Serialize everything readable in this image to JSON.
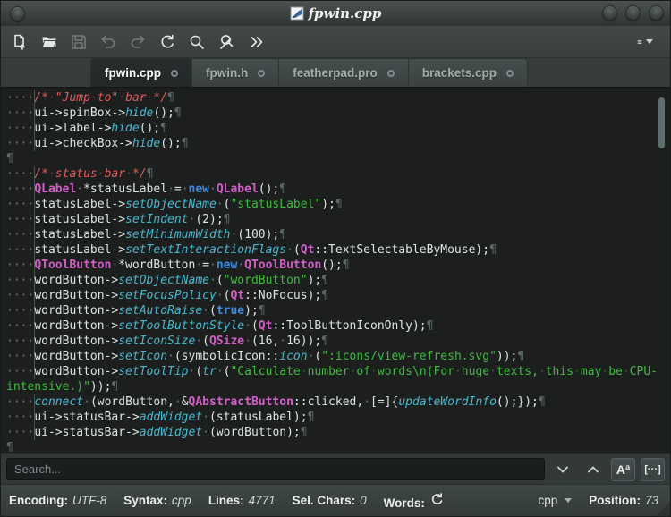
{
  "window": {
    "title": "fpwin.cpp",
    "controls": [
      "window-menu",
      "minimize",
      "maximize",
      "close"
    ]
  },
  "toolbar": {
    "icons": [
      {
        "name": "new-file",
        "enabled": true
      },
      {
        "name": "open-file",
        "enabled": true
      },
      {
        "name": "save",
        "enabled": false
      },
      {
        "name": "undo",
        "enabled": false
      },
      {
        "name": "redo",
        "enabled": false
      },
      {
        "name": "reload",
        "enabled": true
      },
      {
        "name": "find",
        "enabled": true
      },
      {
        "name": "find-replace",
        "enabled": true
      },
      {
        "name": "more-tools",
        "enabled": true
      },
      {
        "name": "main-menu",
        "enabled": true
      }
    ]
  },
  "tabs": [
    {
      "label": "fpwin.cpp",
      "active": true
    },
    {
      "label": "fpwin.h",
      "active": false
    },
    {
      "label": "featherpad.pro",
      "active": false
    },
    {
      "label": "brackets.cpp",
      "active": false
    }
  ],
  "editor": {
    "token_colors": {
      "tx": "#dfe3e3",
      "cm": "#e25b5b",
      "fn": "#49b8cf",
      "kw": "#3f8ae0",
      "ty": "#d45fc8",
      "st": "#3fba3f",
      "pi": "#5d6868",
      "lead": "#dfe3e3"
    },
    "lines": [
      [
        [
          "lead",
          "····"
        ],
        [
          "cm",
          "/*·\"Jump·to\"·bar·*/"
        ],
        [
          "pi",
          "¶"
        ]
      ],
      [
        [
          "lead",
          "····"
        ],
        [
          "tx",
          "ui->spinBox->"
        ],
        [
          "fn",
          "hide"
        ],
        [
          "tx",
          "();"
        ],
        [
          "pi",
          "¶"
        ]
      ],
      [
        [
          "lead",
          "····"
        ],
        [
          "tx",
          "ui->label->"
        ],
        [
          "fn",
          "hide"
        ],
        [
          "tx",
          "();"
        ],
        [
          "pi",
          "¶"
        ]
      ],
      [
        [
          "lead",
          "····"
        ],
        [
          "tx",
          "ui->checkBox->"
        ],
        [
          "fn",
          "hide"
        ],
        [
          "tx",
          "();"
        ],
        [
          "pi",
          "¶"
        ]
      ],
      [
        [
          "pi",
          "¶"
        ]
      ],
      [
        [
          "lead",
          "····"
        ],
        [
          "cm",
          "/*·status·bar·*/"
        ],
        [
          "pi",
          "¶"
        ]
      ],
      [
        [
          "lead",
          "····"
        ],
        [
          "ty",
          "QLabel"
        ],
        [
          "tx",
          "·*statusLabel·=·"
        ],
        [
          "kw",
          "new"
        ],
        [
          "tx",
          "·"
        ],
        [
          "ty",
          "QLabel"
        ],
        [
          "tx",
          "();"
        ],
        [
          "pi",
          "¶"
        ]
      ],
      [
        [
          "lead",
          "····"
        ],
        [
          "tx",
          "statusLabel->"
        ],
        [
          "fn",
          "setObjectName"
        ],
        [
          "tx",
          "·("
        ],
        [
          "st",
          "\"statusLabel\""
        ],
        [
          "tx",
          ");"
        ],
        [
          "pi",
          "¶"
        ]
      ],
      [
        [
          "lead",
          "····"
        ],
        [
          "tx",
          "statusLabel->"
        ],
        [
          "fn",
          "setIndent"
        ],
        [
          "tx",
          "·(2);"
        ],
        [
          "pi",
          "¶"
        ]
      ],
      [
        [
          "lead",
          "····"
        ],
        [
          "tx",
          "statusLabel->"
        ],
        [
          "fn",
          "setMinimumWidth"
        ],
        [
          "tx",
          "·(100);"
        ],
        [
          "pi",
          "¶"
        ]
      ],
      [
        [
          "lead",
          "····"
        ],
        [
          "tx",
          "statusLabel->"
        ],
        [
          "fn",
          "setTextInteractionFlags"
        ],
        [
          "tx",
          "·("
        ],
        [
          "ty",
          "Qt"
        ],
        [
          "tx",
          "::TextSelectableByMouse);"
        ],
        [
          "pi",
          "¶"
        ]
      ],
      [
        [
          "lead",
          "····"
        ],
        [
          "ty",
          "QToolButton"
        ],
        [
          "tx",
          "·*wordButton·=·"
        ],
        [
          "kw",
          "new"
        ],
        [
          "tx",
          "·"
        ],
        [
          "ty",
          "QToolButton"
        ],
        [
          "tx",
          "();"
        ],
        [
          "pi",
          "¶"
        ]
      ],
      [
        [
          "lead",
          "····"
        ],
        [
          "tx",
          "wordButton->"
        ],
        [
          "fn",
          "setObjectName"
        ],
        [
          "tx",
          "·("
        ],
        [
          "st",
          "\"wordButton\""
        ],
        [
          "tx",
          ");"
        ],
        [
          "pi",
          "¶"
        ]
      ],
      [
        [
          "lead",
          "····"
        ],
        [
          "tx",
          "wordButton->"
        ],
        [
          "fn",
          "setFocusPolicy"
        ],
        [
          "tx",
          "·("
        ],
        [
          "ty",
          "Qt"
        ],
        [
          "tx",
          "::NoFocus);"
        ],
        [
          "pi",
          "¶"
        ]
      ],
      [
        [
          "lead",
          "····"
        ],
        [
          "tx",
          "wordButton->"
        ],
        [
          "fn",
          "setAutoRaise"
        ],
        [
          "tx",
          "·("
        ],
        [
          "kw",
          "true"
        ],
        [
          "tx",
          ");"
        ],
        [
          "pi",
          "¶"
        ]
      ],
      [
        [
          "lead",
          "····"
        ],
        [
          "tx",
          "wordButton->"
        ],
        [
          "fn",
          "setToolButtonStyle"
        ],
        [
          "tx",
          "·("
        ],
        [
          "ty",
          "Qt"
        ],
        [
          "tx",
          "::ToolButtonIconOnly);"
        ],
        [
          "pi",
          "¶"
        ]
      ],
      [
        [
          "lead",
          "····"
        ],
        [
          "tx",
          "wordButton->"
        ],
        [
          "fn",
          "setIconSize"
        ],
        [
          "tx",
          "·("
        ],
        [
          "ty",
          "QSize"
        ],
        [
          "tx",
          "·(16,·16));"
        ],
        [
          "pi",
          "¶"
        ]
      ],
      [
        [
          "lead",
          "····"
        ],
        [
          "tx",
          "wordButton->"
        ],
        [
          "fn",
          "setIcon"
        ],
        [
          "tx",
          "·(symbolicIcon::"
        ],
        [
          "fn",
          "icon"
        ],
        [
          "tx",
          "·("
        ],
        [
          "st",
          "\":icons/view-refresh.svg\""
        ],
        [
          "tx",
          "));"
        ],
        [
          "pi",
          "¶"
        ]
      ],
      [
        [
          "lead",
          "····"
        ],
        [
          "tx",
          "wordButton->"
        ],
        [
          "fn",
          "setToolTip"
        ],
        [
          "tx",
          "·("
        ],
        [
          "fn",
          "tr"
        ],
        [
          "tx",
          "·("
        ],
        [
          "st",
          "\"Calculate·number·of·words\\n(For·huge·texts,·this·may·be·CPU-"
        ]
      ],
      [
        [
          "st",
          "intensive.)\""
        ],
        [
          "tx",
          "));"
        ],
        [
          "pi",
          "¶"
        ]
      ],
      [
        [
          "lead",
          "····"
        ],
        [
          "fn",
          "connect"
        ],
        [
          "tx",
          "·(wordButton,·&"
        ],
        [
          "ty",
          "QAbstractButton"
        ],
        [
          "tx",
          "::clicked,·[=]{"
        ],
        [
          "fn",
          "updateWordInfo"
        ],
        [
          "tx",
          "();});"
        ],
        [
          "pi",
          "¶"
        ]
      ],
      [
        [
          "lead",
          "····"
        ],
        [
          "tx",
          "ui->statusBar->"
        ],
        [
          "fn",
          "addWidget"
        ],
        [
          "tx",
          "·(statusLabel);"
        ],
        [
          "pi",
          "¶"
        ]
      ],
      [
        [
          "lead",
          "····"
        ],
        [
          "tx",
          "ui->statusBar->"
        ],
        [
          "fn",
          "addWidget"
        ],
        [
          "tx",
          "·(wordButton);"
        ],
        [
          "pi",
          "¶"
        ]
      ],
      [
        [
          "pi",
          "¶"
        ]
      ]
    ]
  },
  "search": {
    "placeholder": "Search...",
    "case_glyph": "Aª",
    "word_glyph": "[···]",
    "buttons": [
      "next-match",
      "previous-match",
      "case-sensitive",
      "whole-words"
    ]
  },
  "statusbar": {
    "encoding_label": "Encoding:",
    "encoding_value": "UTF-8",
    "syntax_label": "Syntax:",
    "syntax_value": "cpp",
    "lines_label": "Lines:",
    "lines_value": "4771",
    "sel_chars_label": "Sel. Chars:",
    "sel_chars_value": "0",
    "words_label": "Words:",
    "syntax_selector": "cpp",
    "position_label": "Position:",
    "position_value": "73"
  },
  "colors": {
    "chrome": "#3c4242",
    "editor_background": "#1d1f1f",
    "comment": "#e25b5b",
    "function": "#49b8cf",
    "keyword": "#3f8ae0",
    "type": "#d45fc8",
    "string": "#3fba3f",
    "default_text": "#dfe3e3"
  }
}
